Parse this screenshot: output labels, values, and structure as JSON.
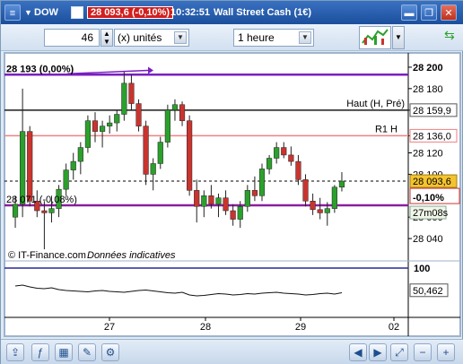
{
  "titlebar": {
    "menu_label": "≡",
    "symbol": "DOW",
    "price_change": "28 093,6 (-0,10%)",
    "time": "10:32:51",
    "instrument": "Wall Street Cash (1€)",
    "minimize": "▬",
    "restore": "❐",
    "close": "✕"
  },
  "toolbar": {
    "period_value": "46",
    "unit_label": "(x) unités",
    "timeframe": "1 heure"
  },
  "chart": {
    "top_marker_label": "28 193 (0,00%)",
    "hline_label": "28 071 (-0,08%)",
    "hline_label_right": "(-0,08%)",
    "haut_label": "Haut (H, Pré)",
    "r1_label": "R1 H",
    "price_ticks": [
      "28 200",
      "28 180",
      "28 159,9",
      "28 136,0",
      "28 120",
      "28 100",
      "28 060",
      "28 040"
    ],
    "current_price": "28 093,6",
    "change_pct": "-0,10%",
    "countdown": "27m08s",
    "credit": "© IT-Finance.com",
    "credit_note": "Données indicatives",
    "date_ticks": [
      "27",
      "28",
      "29",
      "02"
    ],
    "osc_top": "100",
    "osc_value": "50,462",
    "colors": {
      "up": "#2ca02c",
      "down": "#c9342f",
      "resistance": "#f08080",
      "support": "#8a1fa0",
      "haut": "#1a1a1a",
      "marker": "#7a1fc0"
    }
  },
  "chart_data": {
    "type": "candlestick",
    "title": "Wall Street Cash (1€)",
    "timeframe": "1 heure",
    "xlabel": "",
    "ylabel": "",
    "ylim": [
      28025,
      28210
    ],
    "x_ticks": [
      "27",
      "28",
      "29",
      "02"
    ],
    "candles": [
      {
        "o": 28060,
        "h": 28080,
        "l": 28050,
        "c": 28072
      },
      {
        "o": 28072,
        "h": 28180,
        "l": 28060,
        "c": 28140
      },
      {
        "o": 28140,
        "h": 28145,
        "l": 28070,
        "c": 28075
      },
      {
        "o": 28075,
        "h": 28085,
        "l": 28060,
        "c": 28066
      },
      {
        "o": 28066,
        "h": 28075,
        "l": 28030,
        "c": 28064
      },
      {
        "o": 28064,
        "h": 28080,
        "l": 28055,
        "c": 28068
      },
      {
        "o": 28068,
        "h": 28090,
        "l": 28060,
        "c": 28086
      },
      {
        "o": 28086,
        "h": 28110,
        "l": 28080,
        "c": 28104
      },
      {
        "o": 28104,
        "h": 28120,
        "l": 28095,
        "c": 28112
      },
      {
        "o": 28112,
        "h": 28130,
        "l": 28100,
        "c": 28125
      },
      {
        "o": 28125,
        "h": 28155,
        "l": 28120,
        "c": 28150
      },
      {
        "o": 28150,
        "h": 28158,
        "l": 28130,
        "c": 28140
      },
      {
        "o": 28140,
        "h": 28150,
        "l": 28125,
        "c": 28145
      },
      {
        "o": 28145,
        "h": 28155,
        "l": 28138,
        "c": 28148
      },
      {
        "o": 28148,
        "h": 28160,
        "l": 28140,
        "c": 28156
      },
      {
        "o": 28156,
        "h": 28196,
        "l": 28150,
        "c": 28185
      },
      {
        "o": 28185,
        "h": 28193,
        "l": 28160,
        "c": 28166
      },
      {
        "o": 28166,
        "h": 28170,
        "l": 28140,
        "c": 28145
      },
      {
        "o": 28145,
        "h": 28150,
        "l": 28090,
        "c": 28100
      },
      {
        "o": 28100,
        "h": 28115,
        "l": 28085,
        "c": 28110
      },
      {
        "o": 28110,
        "h": 28135,
        "l": 28105,
        "c": 28130
      },
      {
        "o": 28130,
        "h": 28165,
        "l": 28125,
        "c": 28160
      },
      {
        "o": 28160,
        "h": 28170,
        "l": 28150,
        "c": 28165
      },
      {
        "o": 28165,
        "h": 28168,
        "l": 28145,
        "c": 28150
      },
      {
        "o": 28150,
        "h": 28155,
        "l": 28080,
        "c": 28085
      },
      {
        "o": 28085,
        "h": 28095,
        "l": 28055,
        "c": 28070
      },
      {
        "o": 28070,
        "h": 28085,
        "l": 28060,
        "c": 28080
      },
      {
        "o": 28080,
        "h": 28090,
        "l": 28068,
        "c": 28072
      },
      {
        "o": 28072,
        "h": 28082,
        "l": 28060,
        "c": 28078
      },
      {
        "o": 28078,
        "h": 28085,
        "l": 28062,
        "c": 28066
      },
      {
        "o": 28066,
        "h": 28072,
        "l": 28052,
        "c": 28058
      },
      {
        "o": 28058,
        "h": 28075,
        "l": 28050,
        "c": 28070
      },
      {
        "o": 28070,
        "h": 28090,
        "l": 28065,
        "c": 28085
      },
      {
        "o": 28085,
        "h": 28098,
        "l": 28075,
        "c": 28080
      },
      {
        "o": 28080,
        "h": 28110,
        "l": 28075,
        "c": 28105
      },
      {
        "o": 28105,
        "h": 28118,
        "l": 28100,
        "c": 28115
      },
      {
        "o": 28115,
        "h": 28130,
        "l": 28110,
        "c": 28125
      },
      {
        "o": 28125,
        "h": 28130,
        "l": 28115,
        "c": 28118
      },
      {
        "o": 28118,
        "h": 28126,
        "l": 28108,
        "c": 28112
      },
      {
        "o": 28112,
        "h": 28118,
        "l": 28090,
        "c": 28095
      },
      {
        "o": 28095,
        "h": 28100,
        "l": 28070,
        "c": 28075
      },
      {
        "o": 28075,
        "h": 28082,
        "l": 28062,
        "c": 28067
      },
      {
        "o": 28067,
        "h": 28078,
        "l": 28058,
        "c": 28064
      },
      {
        "o": 28064,
        "h": 28074,
        "l": 28052,
        "c": 28068
      },
      {
        "o": 28068,
        "h": 28090,
        "l": 28064,
        "c": 28088
      },
      {
        "o": 28088,
        "h": 28102,
        "l": 28084,
        "c": 28093.6
      }
    ],
    "lines": [
      {
        "name": "Haut (H, Pré)",
        "value": 28159.9
      },
      {
        "name": "R1 H",
        "value": 28136.0
      },
      {
        "name": "28 071 (-0,08%)",
        "value": 28071
      },
      {
        "name": "28 193 (0,00%)",
        "value": 28193
      }
    ],
    "oscillator": [
      60,
      62,
      58,
      55,
      54,
      56,
      52,
      50,
      49,
      48,
      47,
      49,
      50,
      48,
      47,
      46,
      48,
      50,
      51,
      49,
      47,
      45,
      44,
      46,
      40,
      38,
      39,
      41,
      43,
      42,
      40,
      41,
      43,
      42,
      44,
      45,
      46,
      44,
      43,
      42,
      40,
      41,
      43,
      44,
      42,
      45
    ]
  }
}
